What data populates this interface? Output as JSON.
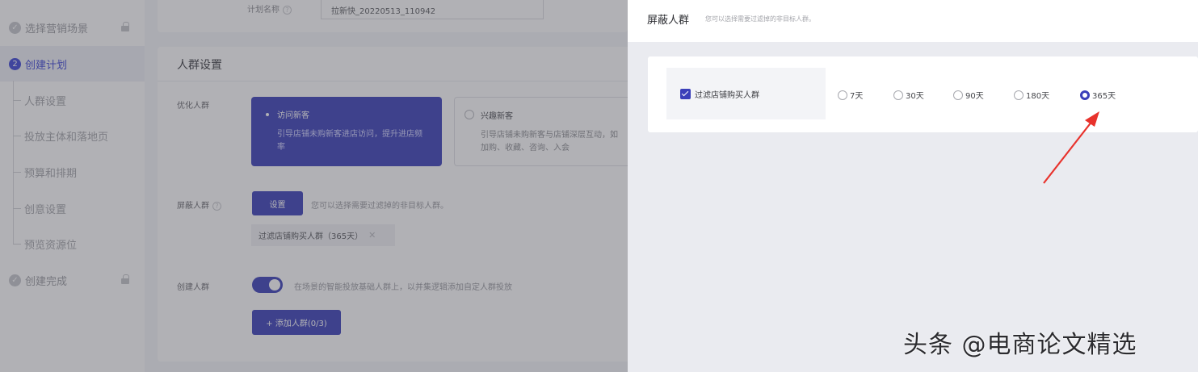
{
  "sidebar": {
    "items": [
      {
        "label": "选择营销场景",
        "step": "",
        "locked": true
      },
      {
        "label": "创建计划",
        "step": "2",
        "locked": false
      },
      {
        "label": "创建完成",
        "step": "",
        "locked": true
      }
    ],
    "sub_items": [
      "人群设置",
      "投放主体和落地页",
      "预算和排期",
      "创意设置",
      "预览资源位"
    ]
  },
  "plan": {
    "name_label": "计划名称",
    "name_value": "拉新快_20220513_110942"
  },
  "crowd_settings": {
    "title": "人群设置",
    "optimize_label": "优化人群",
    "options": [
      {
        "title": "访问新客",
        "desc": "引导店铺未购新客进店访问，提升进店频率",
        "selected": true
      },
      {
        "title": "兴趣新客",
        "desc": "引导店铺未购新客与店铺深层互动，如加购、收藏、咨询、入会",
        "selected": false
      }
    ],
    "block_label": "屏蔽人群",
    "set_button": "设置",
    "block_hint": "您可以选择需要过滤掉的非目标人群。",
    "block_tag": "过滤店铺购买人群（365天）",
    "create_label": "创建人群",
    "toggle_hint": "在场景的智能投放基础人群上，以并集逻辑添加自定人群投放",
    "toggle_on": true,
    "add_button": "+ 添加人群(0/3)"
  },
  "drawer": {
    "title": "屏蔽人群",
    "subtitle": "您可以选择需要过滤掉的非目标人群。",
    "checkbox_label": "过滤店铺购买人群",
    "checkbox_checked": true,
    "radio_options": [
      "7天",
      "30天",
      "90天",
      "180天",
      "365天"
    ],
    "selected_radio": "365天"
  },
  "watermark": "头条 @电商论文精选",
  "colors": {
    "primary": "#3a3fb9",
    "arrow": "#e8322c"
  }
}
